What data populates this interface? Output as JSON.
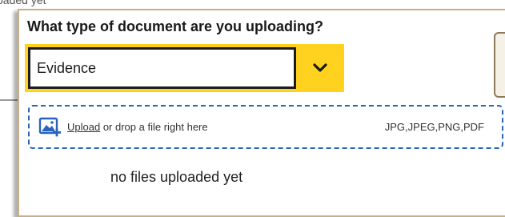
{
  "background": {
    "partial_text": "oaded yet"
  },
  "modal": {
    "question": "What type of document are you uploading?",
    "select": {
      "value": "Evidence"
    },
    "dropzone": {
      "upload_link": "Upload",
      "drop_text": " or drop a file right here",
      "file_types": "JPG,JPEG,PNG,PDF"
    },
    "empty_state": "no files uploaded yet"
  },
  "icons": {
    "select_toggle": "chevron-down-icon",
    "upload": "image-upload-icon"
  },
  "colors": {
    "accent_yellow": "#ffd21f",
    "dropzone_blue": "#2a63bd",
    "modal_border": "#c6b08a"
  }
}
